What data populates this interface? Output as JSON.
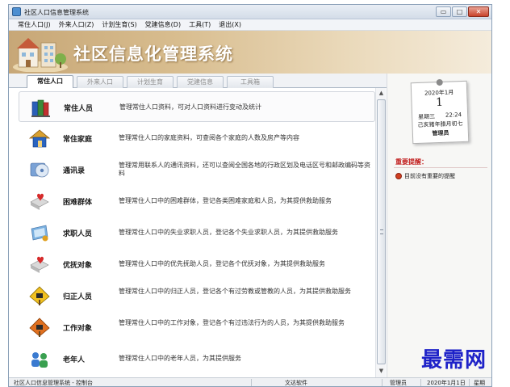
{
  "window": {
    "title": "社区人口信息管理系统"
  },
  "window_controls": {
    "minimize": "▭",
    "maximize": "□",
    "close": "✕"
  },
  "menu": [
    "常住人口(J)",
    "外来人口(Z)",
    "计划生育(S)",
    "党建信息(D)",
    "工具(T)",
    "退出(X)"
  ],
  "banner": {
    "title": "社区信息化管理系统"
  },
  "tabs": [
    {
      "label": "常住人口",
      "active": true
    },
    {
      "label": "外来人口",
      "active": false
    },
    {
      "label": "计划生育",
      "active": false
    },
    {
      "label": "党建信息",
      "active": false
    },
    {
      "label": "工具箱",
      "active": false
    }
  ],
  "items": [
    {
      "name": "常住人员",
      "icon": "books-icon",
      "desc": "管理常住人口资料，可对人口资料进行变动及统计"
    },
    {
      "name": "常住家庭",
      "icon": "house-icon",
      "desc": "管理常住人口的家庭资料，可查阅各个家庭的人数及房产等内容"
    },
    {
      "name": "通讯录",
      "icon": "disc-icon",
      "desc": "管理常用联系人的通讯资料，还可以查阅全国各地的行政区划及电话区号和邮政编码等资料"
    },
    {
      "name": "困难群体",
      "icon": "heart-book-icon",
      "desc": "管理常住人口中的困难群体，登记各类困难家庭和人员，为其提供救助服务"
    },
    {
      "name": "求职人员",
      "icon": "screen-icon",
      "desc": "管理常住人口中的失业求职人员，登记各个失业求职人员，为其提供救助服务"
    },
    {
      "name": "优抚对象",
      "icon": "heart-book-icon",
      "desc": "管理常住人口中的优先抚助人员，登记各个优抚对象，为其提供救助服务"
    },
    {
      "name": "归正人员",
      "icon": "sign-icon",
      "desc": "管理常住人口中的归正人员，登记各个有过劳教或管教的人员，为其提供救助服务"
    },
    {
      "name": "工作对象",
      "icon": "sign-icon",
      "desc": "管理常住人口中的工作对象，登记各个有过违法行为的人员，为其提供救助服务"
    },
    {
      "name": "老年人",
      "icon": "people-icon",
      "desc": "管理常住人口中的老年人员，为其提供服务"
    }
  ],
  "calendar": {
    "month": "2020年1月",
    "day": "1",
    "weekday": "星期三",
    "time": "22:24",
    "lunar": "己亥猪年腊月初七",
    "user": "管理员"
  },
  "reminders": {
    "title": "重要提醒：",
    "items": [
      "目前没有重要的提醒"
    ]
  },
  "statusbar": {
    "left": "社区人口信息管理系统 - 控制台",
    "company": "文达软件",
    "user": "管理员",
    "date": "2020年1月1日",
    "weekday": "星期"
  },
  "watermark": "最需网",
  "colors": {
    "banner_start": "#c7a777",
    "banner_end": "#f5ecdc",
    "reminder_title": "#c22020",
    "watermark": "#1e22c8"
  }
}
